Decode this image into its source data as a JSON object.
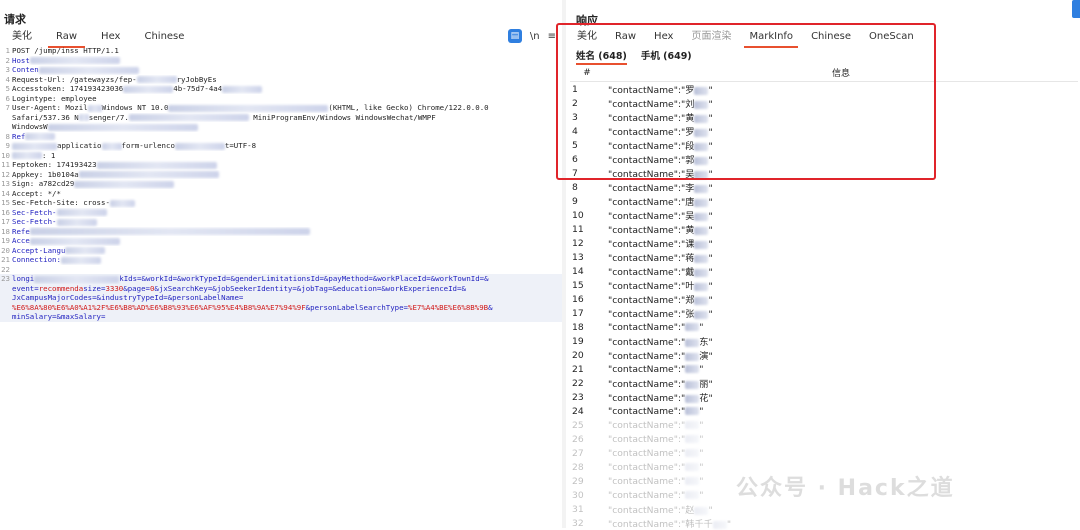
{
  "request": {
    "title": "请求",
    "tabs": [
      "美化",
      "Raw",
      "Hex",
      "Chinese"
    ],
    "active_tab": "Raw",
    "tool_wrap": "\\n",
    "tool_menu": "≡",
    "lines": [
      {
        "n": "1",
        "parts": [
          {
            "t": "POST /jump/inss HTTP/1.1"
          }
        ]
      },
      {
        "n": "2",
        "parts": [
          {
            "t": "Host",
            "c": "k"
          },
          {
            "b": 90
          }
        ]
      },
      {
        "n": "3",
        "parts": [
          {
            "t": "Conten",
            "c": "k"
          },
          {
            "b": 100
          }
        ]
      },
      {
        "n": "4",
        "parts": [
          {
            "t": "Request-Url: /gatewayzs/fep-"
          },
          {
            "b": 40
          },
          {
            "t": "ryJobByEs"
          }
        ]
      },
      {
        "n": "5",
        "parts": [
          {
            "t": "Accesstoken: 174193423036"
          },
          {
            "b": 50
          },
          {
            "t": "4b-75d7-4a4"
          },
          {
            "b": 40
          }
        ]
      },
      {
        "n": "6",
        "parts": [
          {
            "t": "Logintype: employee"
          }
        ]
      },
      {
        "n": "7",
        "parts": [
          {
            "t": "User-Agent: Mozil"
          },
          {
            "b": 14
          },
          {
            "t": "Windows NT 10.0"
          },
          {
            "b": 160
          },
          {
            "t": "(KHTML, like Gecko) Chrome/122.0.0.0"
          }
        ]
      },
      {
        "n": "",
        "parts": [
          {
            "t": "Safari/537.36 N"
          },
          {
            "b": 10
          },
          {
            "t": "senger/7."
          },
          {
            "b": 120
          },
          {
            "t": " MiniProgramEnv/Windows WindowsWechat/WMPF"
          }
        ]
      },
      {
        "n": "",
        "parts": [
          {
            "t": "WindowsW"
          },
          {
            "b": 150
          }
        ]
      },
      {
        "n": "8",
        "parts": [
          {
            "t": "Ref",
            "c": "k"
          },
          {
            "b": 30
          }
        ]
      },
      {
        "n": "9",
        "parts": [
          {
            "b": 45
          },
          {
            "t": "applicatio"
          },
          {
            "b": 20
          },
          {
            "t": "form-urlenco"
          },
          {
            "b": 50
          },
          {
            "t": "t=UTF-8"
          }
        ]
      },
      {
        "n": "10",
        "parts": [
          {
            "b": 30
          },
          {
            "t": ": 1"
          }
        ]
      },
      {
        "n": "11",
        "parts": [
          {
            "t": "Feptoken: 174193423"
          },
          {
            "b": 120
          }
        ]
      },
      {
        "n": "12",
        "parts": [
          {
            "t": "Appkey: 1b0104a"
          },
          {
            "b": 140
          }
        ]
      },
      {
        "n": "13",
        "parts": [
          {
            "t": "Sign: a782cd29"
          },
          {
            "b": 100
          }
        ]
      },
      {
        "n": "14",
        "parts": [
          {
            "t": "Accept: */*"
          }
        ]
      },
      {
        "n": "15",
        "parts": [
          {
            "t": "Sec-Fetch-Site: cross-"
          },
          {
            "b": 25
          }
        ]
      },
      {
        "n": "16",
        "parts": [
          {
            "t": "Sec-Fetch-",
            "c": "k"
          },
          {
            "b": 50
          }
        ]
      },
      {
        "n": "17",
        "parts": [
          {
            "t": "Sec-Fetch-",
            "c": "k"
          },
          {
            "b": 40
          }
        ]
      },
      {
        "n": "18",
        "parts": [
          {
            "t": "Refe",
            "c": "k"
          },
          {
            "b": 280
          }
        ]
      },
      {
        "n": "19",
        "parts": [
          {
            "t": "Acce",
            "c": "k"
          },
          {
            "b": 90
          }
        ]
      },
      {
        "n": "20",
        "parts": [
          {
            "t": "Accept-Langu",
            "c": "k"
          },
          {
            "b": 40
          }
        ]
      },
      {
        "n": "21",
        "parts": [
          {
            "t": "Connection:",
            "c": "k"
          },
          {
            "b": 40
          }
        ]
      },
      {
        "n": "22",
        "parts": [
          {
            "t": ""
          }
        ]
      },
      {
        "n": "23",
        "sel": true,
        "parts": [
          {
            "t": "longi",
            "c": "k"
          },
          {
            "b": 85
          },
          {
            "t": "kIds=&workId=&workTypeId=&genderLimitationsId=&payMethod=&workPlaceId=&workTownId=&",
            "c": "k"
          }
        ]
      },
      {
        "n": "",
        "sel": true,
        "parts": [
          {
            "t": "event=",
            "c": "k"
          },
          {
            "t": "recommenda",
            "c": "r"
          },
          {
            "t": "size=",
            "c": "k"
          },
          {
            "t": "3330",
            "c": "r"
          },
          {
            "t": "&page=",
            "c": "k"
          },
          {
            "t": "0",
            "c": "r"
          },
          {
            "t": "&jxSearchKey=&jobSeekerIdentity=&jobTag=&education=&workExperienceId=&",
            "c": "k"
          }
        ]
      },
      {
        "n": "",
        "sel": true,
        "parts": [
          {
            "t": "JxCampusMajorCodes=&industryTypeId=&personLabelName=",
            "c": "k"
          }
        ]
      },
      {
        "n": "",
        "sel": true,
        "parts": [
          {
            "t": "%E6%8A%80%E6%A0%A1%2F%E6%B8%AD%E6%B8%93%E6%AF%95%E4%B8%9A%E7%94%9F",
            "c": "r"
          },
          {
            "t": "&personLabelSearchType=",
            "c": "k"
          },
          {
            "t": "%E7%A4%BE%E6%8B%9B",
            "c": "r"
          },
          {
            "t": "&",
            "c": "k"
          }
        ]
      },
      {
        "n": "",
        "sel": true,
        "parts": [
          {
            "t": "minSalary=&maxSalary=",
            "c": "k"
          }
        ]
      }
    ]
  },
  "response": {
    "title": "响应",
    "tabs": [
      "美化",
      "Raw",
      "Hex",
      "页面渲染",
      "MarkInfo",
      "Chinese",
      "OneScan"
    ],
    "active_tab": "MarkInfo",
    "subtabs": [
      "姓名 (648)",
      "手机 (649)"
    ],
    "active_subtab": "姓名 (648)",
    "columns": [
      "#",
      "信息"
    ],
    "rows": [
      {
        "n": "1",
        "v": "\"contactName\":\"罗",
        "tail": "\""
      },
      {
        "n": "2",
        "v": "\"contactName\":\"刘",
        "tail": "\""
      },
      {
        "n": "3",
        "v": "\"contactName\":\"黄",
        "tail": "\""
      },
      {
        "n": "4",
        "v": "\"contactName\":\"罗",
        "tail": "\""
      },
      {
        "n": "5",
        "v": "\"contactName\":\"段",
        "tail": "\""
      },
      {
        "n": "6",
        "v": "\"contactName\":\"郭",
        "tail": "\""
      },
      {
        "n": "7",
        "v": "\"contactName\":\"吴",
        "tail": "\""
      },
      {
        "n": "8",
        "v": "\"contactName\":\"李",
        "tail": "\""
      },
      {
        "n": "9",
        "v": "\"contactName\":\"唐",
        "tail": "\""
      },
      {
        "n": "10",
        "v": "\"contactName\":\"吴",
        "tail": "\""
      },
      {
        "n": "11",
        "v": "\"contactName\":\"黄",
        "tail": "\""
      },
      {
        "n": "12",
        "v": "\"contactName\":\"课",
        "tail": "\""
      },
      {
        "n": "13",
        "v": "\"contactName\":\"蒋",
        "tail": "\""
      },
      {
        "n": "14",
        "v": "\"contactName\":\"戴",
        "tail": "\""
      },
      {
        "n": "15",
        "v": "\"contactName\":\"叶",
        "tail": "\""
      },
      {
        "n": "16",
        "v": "\"contactName\":\"郑",
        "tail": "\""
      },
      {
        "n": "17",
        "v": "\"contactName\":\"张",
        "tail": "\""
      },
      {
        "n": "18",
        "v": "\"contactName\":\"",
        "tail": "\""
      },
      {
        "n": "19",
        "v": "\"contactName\":\"",
        "tail": "东\""
      },
      {
        "n": "20",
        "v": "\"contactName\":\"",
        "tail": "演\""
      },
      {
        "n": "21",
        "v": "\"contactName\":\"",
        "tail": "\""
      },
      {
        "n": "22",
        "v": "\"contactName\":\"",
        "tail": "丽\""
      },
      {
        "n": "23",
        "v": "\"contactName\":\"",
        "tail": "花\""
      },
      {
        "n": "24",
        "v": "\"contactName\":\"",
        "tail": "\""
      },
      {
        "n": "25",
        "v": "\"contactName\":\"",
        "tail": "\"",
        "faded": true
      },
      {
        "n": "26",
        "v": "\"contactName\":\"",
        "tail": "\"",
        "faded": true
      },
      {
        "n": "27",
        "v": "\"contactName\":\"",
        "tail": "\"",
        "faded": true
      },
      {
        "n": "28",
        "v": "\"contactName\":\"",
        "tail": "\"",
        "faded": true
      },
      {
        "n": "29",
        "v": "\"contactName\":\"",
        "tail": "\"",
        "faded": true
      },
      {
        "n": "30",
        "v": "\"contactName\":\"",
        "tail": "\"",
        "faded": true
      },
      {
        "n": "31",
        "v": "\"contactName\":\"赵",
        "tail": "\"",
        "faded": true
      },
      {
        "n": "32",
        "v": "\"contactName\":\"韩千千",
        "tail": "\"",
        "faded": true
      }
    ]
  },
  "watermark": "公众号 · Hack之道",
  "colors": {
    "accent": "#e8502f",
    "highlight": "#e0242a",
    "keyword": "#1f1fbf",
    "param": "#d11a1a",
    "tool": "#2f7fe0"
  }
}
